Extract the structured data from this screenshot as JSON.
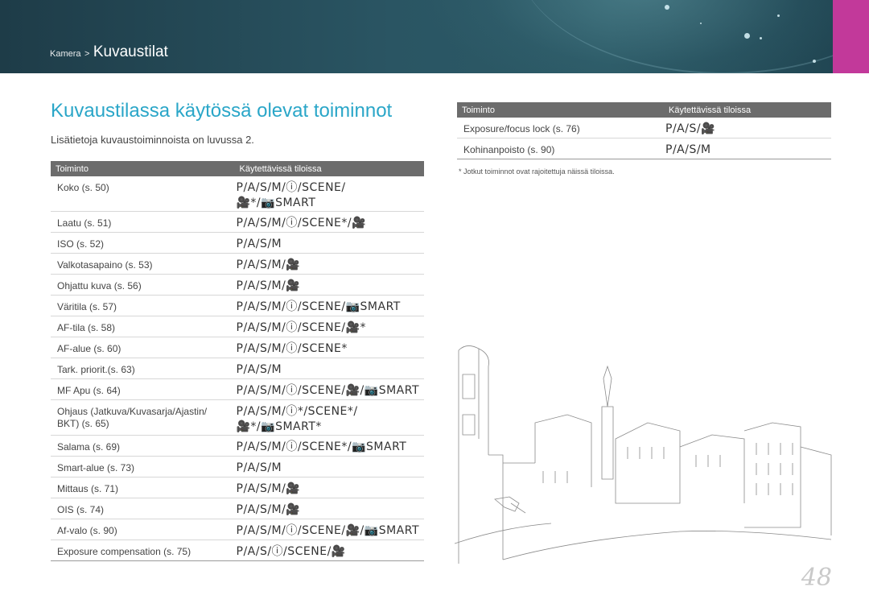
{
  "header": {
    "section": "Kamera",
    "separator": ">",
    "title": "Kuvaustilat"
  },
  "colors": {
    "banner": "#2a5563",
    "accent_tab": "#c2399a",
    "title": "#2aa6c8",
    "table_header": "#6c6c6c"
  },
  "page": {
    "title": "Kuvaustilassa käytössä olevat toiminnot",
    "subtitle": "Lisätietoja kuvaustoiminnoista on luvussa 2.",
    "number": "48"
  },
  "left_table": {
    "headers": [
      "Toiminto",
      "Käytettävissä tiloissa"
    ],
    "rows": [
      {
        "name": "Koko (s. 50)",
        "modes": [
          "P/A/S/M/ⓘ/SCENE/",
          "🎥*/📷SMART"
        ]
      },
      {
        "name": "Laatu (s. 51)",
        "modes": [
          "P/A/S/M/ⓘ/SCENE*/🎥"
        ]
      },
      {
        "name": "ISO (s. 52)",
        "modes": [
          "P/A/S/M"
        ]
      },
      {
        "name": "Valkotasapaino (s. 53)",
        "modes": [
          "P/A/S/M/🎥"
        ]
      },
      {
        "name": "Ohjattu kuva (s. 56)",
        "modes": [
          "P/A/S/M/🎥"
        ]
      },
      {
        "name": "Väritila  (s. 57)",
        "modes": [
          "P/A/S/M/ⓘ/SCENE/📷SMART"
        ]
      },
      {
        "name": "AF-tila (s. 58)",
        "modes": [
          "P/A/S/M/ⓘ/SCENE/🎥*"
        ]
      },
      {
        "name": "AF-alue (s. 60)",
        "modes": [
          "P/A/S/M/ⓘ/SCENE*"
        ]
      },
      {
        "name": "Tark. priorit.(s. 63)",
        "modes": [
          "P/A/S/M"
        ]
      },
      {
        "name": "MF Apu (s. 64)",
        "modes": [
          "P/A/S/M/ⓘ/SCENE/🎥/📷SMART"
        ]
      },
      {
        "name": "Ohjaus (Jatkuva/Kuvasarja/Ajastin/ BKT) (s. 65)",
        "modes": [
          "P/A/S/M/ⓘ*/SCENE*/",
          "🎥*/📷SMART*"
        ]
      },
      {
        "name": "Salama (s. 69)",
        "modes": [
          "P/A/S/M/ⓘ/SCENE*/📷SMART"
        ]
      },
      {
        "name": "Smart-alue (s. 73)",
        "modes": [
          "P/A/S/M"
        ]
      },
      {
        "name": "Mittaus (s. 71)",
        "modes": [
          "P/A/S/M/🎥"
        ]
      },
      {
        "name": "OIS (s. 74)",
        "modes": [
          "P/A/S/M/🎥"
        ]
      },
      {
        "name": "Af-valo (s. 90)",
        "modes": [
          "P/A/S/M/ⓘ/SCENE/🎥/📷SMART"
        ]
      },
      {
        "name": "Exposure compensation (s. 75)",
        "modes": [
          "P/A/S/ⓘ/SCENE/🎥"
        ]
      }
    ]
  },
  "right_table": {
    "headers": [
      "Toiminto",
      "Käytettävissä tiloissa"
    ],
    "rows": [
      {
        "name": "Exposure/focus lock  (s. 76)",
        "modes": [
          "P/A/S/🎥"
        ]
      },
      {
        "name": "Kohinanpoisto (s. 90)",
        "modes": [
          "P/A/S/M"
        ]
      }
    ]
  },
  "footnote": "* Jotkut toiminnot ovat rajoitettuja näissä tiloissa."
}
